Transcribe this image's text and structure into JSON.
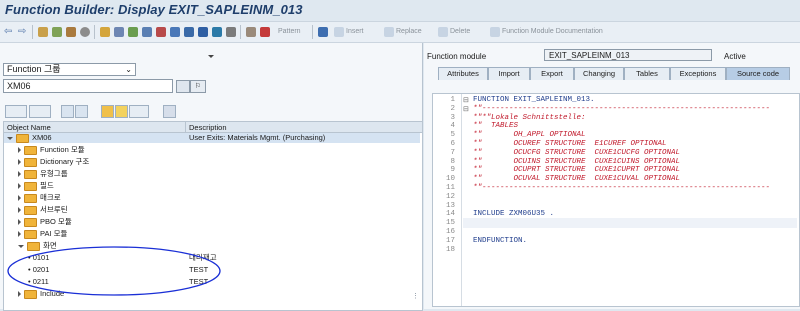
{
  "window": {
    "title": "Function Builder: Display EXIT_SAPLEINM_013"
  },
  "toolbar": {
    "pattern": "Pattern",
    "insert": "Insert",
    "replace": "Replace",
    "delete": "Delete",
    "documentation": "Function Module Documentation"
  },
  "left": {
    "object_type": "Function 그룹",
    "object_name": "XM06",
    "columns": {
      "name": "Object Name",
      "desc": "Description"
    },
    "root": {
      "name": "XM06",
      "desc": "User Exits: Materials Mgmt. (Purchasing)"
    },
    "nodes": [
      "Function 모듈",
      "Dictionary 구조",
      "유형그룹",
      "필드",
      "매크로",
      "서브루틴",
      "PBO 모듈",
      "PAI 모듈",
      "화면"
    ],
    "screens": [
      {
        "name": "0101",
        "desc": "대리재고"
      },
      {
        "name": "0201",
        "desc": "TEST"
      },
      {
        "name": "0211",
        "desc": "TEST"
      }
    ],
    "include_node": "Include"
  },
  "right": {
    "fm_label": "Function module",
    "fm_value": "EXIT_SAPLEINM_013",
    "status": "Active",
    "tabs": [
      "Attributes",
      "Import",
      "Export",
      "Changing",
      "Tables",
      "Exceptions",
      "Source code"
    ],
    "code": [
      {
        "n": "1",
        "text": "FUNCTION EXIT_SAPLEINM_013.",
        "style": "kw"
      },
      {
        "n": "2",
        "text": "*\"----------------------------------------------------------------",
        "style": "cm"
      },
      {
        "n": "3",
        "text": "*\"*\"Lokale Schnittstelle:",
        "style": "cm"
      },
      {
        "n": "4",
        "text": "*\"  TABLES",
        "style": "cm"
      },
      {
        "n": "5",
        "text": "*\"       OH_APPL OPTIONAL",
        "style": "cm"
      },
      {
        "n": "6",
        "text": "*\"       OCUREF STRUCTURE  E1CUREF OPTIONAL",
        "style": "cm"
      },
      {
        "n": "7",
        "text": "*\"       OCUCFG STRUCTURE  CUXE1CUCFG OPTIONAL",
        "style": "cm"
      },
      {
        "n": "8",
        "text": "*\"       OCUINS STRUCTURE  CUXE1CUINS OPTIONAL",
        "style": "cm"
      },
      {
        "n": "9",
        "text": "*\"       OCUPRT STRUCTURE  CUXE1CUPRT OPTIONAL",
        "style": "cm"
      },
      {
        "n": "10",
        "text": "*\"       OCUVAL STRUCTURE  CUXE1CUVAL OPTIONAL",
        "style": "cm"
      },
      {
        "n": "11",
        "text": "*\"----------------------------------------------------------------",
        "style": "cm"
      },
      {
        "n": "12",
        "text": "",
        "style": ""
      },
      {
        "n": "13",
        "text": "",
        "style": ""
      },
      {
        "n": "14",
        "text": "INCLUDE ZXM06U35 .",
        "style": "kw"
      },
      {
        "n": "15",
        "text": "",
        "style": ""
      },
      {
        "n": "16",
        "text": "",
        "style": ""
      },
      {
        "n": "17",
        "text": "ENDFUNCTION.",
        "style": "kw"
      },
      {
        "n": "18",
        "text": "",
        "style": ""
      }
    ]
  }
}
